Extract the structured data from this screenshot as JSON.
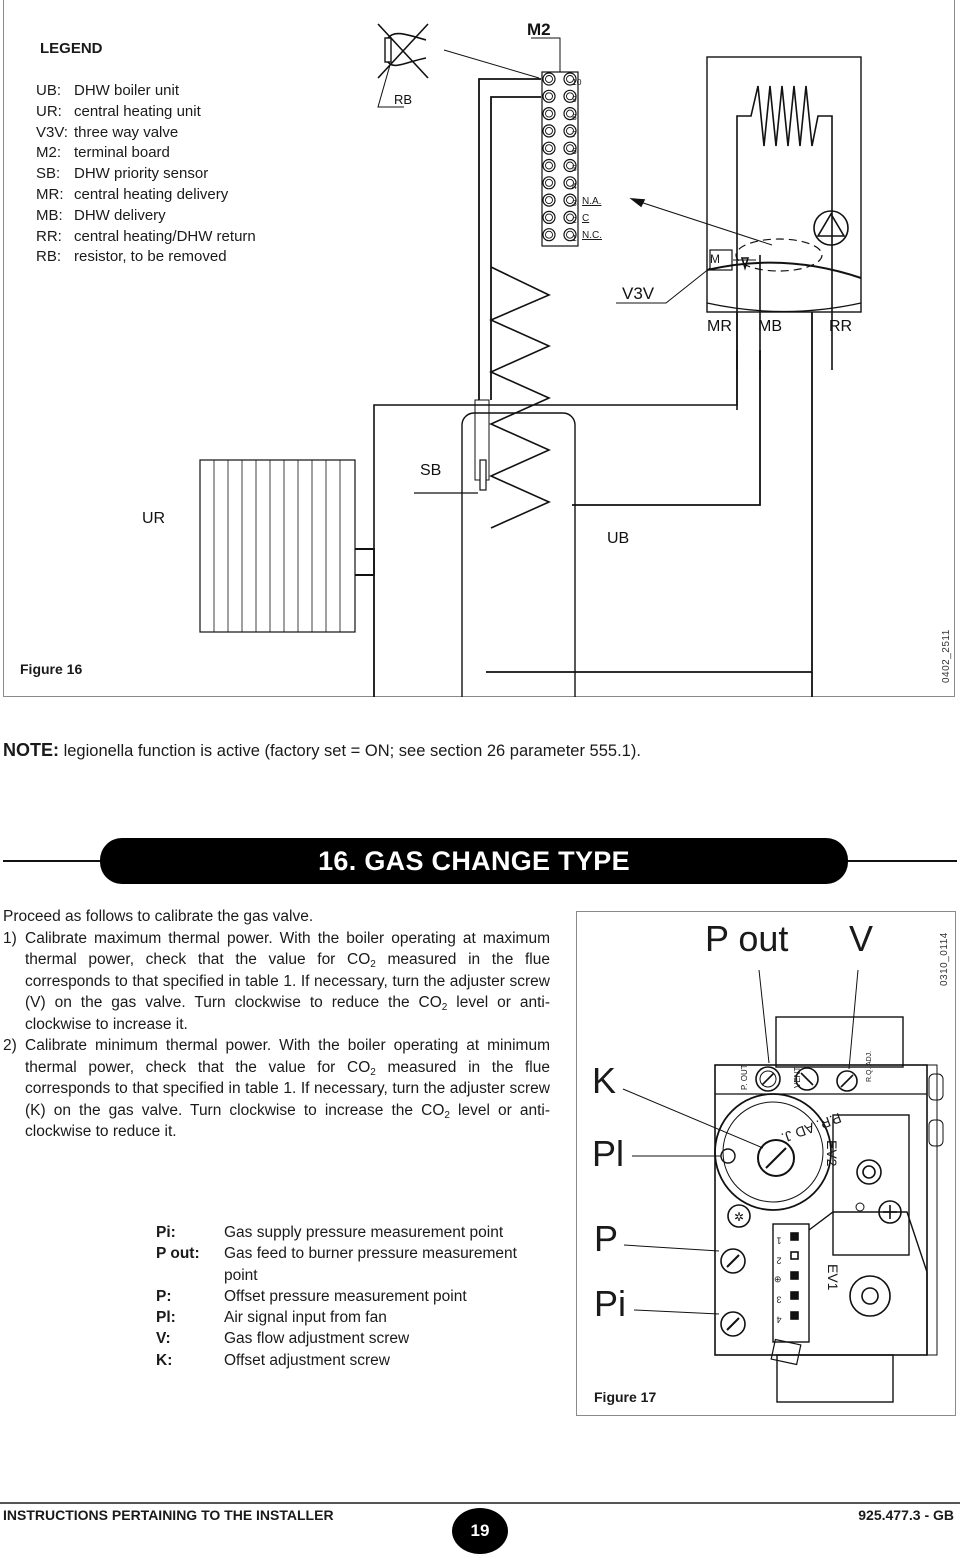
{
  "figure16": {
    "legend_title": "LEGEND",
    "legend": [
      {
        "key": "UB:",
        "value": "DHW boiler unit"
      },
      {
        "key": "UR:",
        "value": "central heating unit"
      },
      {
        "key": "V3V:",
        "value": "three way valve"
      },
      {
        "key": "M2:",
        "value": "terminal board"
      },
      {
        "key": "SB:",
        "value": "DHW priority sensor"
      },
      {
        "key": "MR:",
        "value": "central heating delivery"
      },
      {
        "key": "MB:",
        "value": "DHW delivery"
      },
      {
        "key": "RR:",
        "value": "central heating/DHW return"
      },
      {
        "key": "RB:",
        "value": "resistor, to be removed"
      }
    ],
    "labels": {
      "rb": "RB",
      "m2": "M2",
      "v3v": "V3V",
      "mr": "MR",
      "mb": "MB",
      "rr": "RR",
      "sb": "SB",
      "ur": "UR",
      "ub": "UB",
      "motor": "M",
      "terminal_na": "N.A.",
      "terminal_c": "C",
      "terminal_nc": "N.C."
    },
    "terminal_numbers": [
      "10",
      "9",
      "8",
      "7",
      "6",
      "5",
      "4",
      "3",
      "2",
      "1"
    ],
    "caption": "Figure 16",
    "code": "0402_2511"
  },
  "note": {
    "label": "NOTE:",
    "text": " legionella function is active (factory set = ON; see section 26 parameter 555.1)."
  },
  "section": {
    "heading": "16. GAS CHANGE TYPE",
    "intro": "Proceed as follows to calibrate the gas valve.",
    "steps": [
      {
        "num": "1)",
        "a": "Calibrate maximum thermal power. With the boiler operating at maximum thermal power, check that the value for CO",
        "b": " measured in the flue corresponds to that specified in table 1. If necessary, turn the adjuster screw (V) on the gas valve. Turn clockwise to reduce the CO",
        "c": " level or anti-clockwise to increase it."
      },
      {
        "num": "2)",
        "a": "Calibrate minimum thermal power. With the boiler operating at minimum thermal power, check that the value for CO",
        "b": " measured in the flue corresponds to that specified in table 1. If necessary, turn the adjuster screw (K) on the gas valve. Turn clockwise to increase the CO",
        "c": " level or anti-clockwise to reduce it."
      }
    ],
    "subscript": "2"
  },
  "symbols": [
    {
      "key": "Pi:",
      "value": "Gas supply pressure measurement point"
    },
    {
      "key": "P out:",
      "value": "Gas feed to burner pressure measurement point"
    },
    {
      "key": "P:",
      "value": "Offset pressure measurement point"
    },
    {
      "key": "Pl:",
      "value": "Air signal input from fan"
    },
    {
      "key": "V:",
      "value": "Gas flow adjustment screw"
    },
    {
      "key": "K:",
      "value": "Offset adjustment screw"
    }
  ],
  "figure17": {
    "labels": {
      "p_out": "P out",
      "v": "V",
      "k": "K",
      "pl": "Pl",
      "p": "P",
      "pi": "Pi",
      "p_out_small": "P. OUT",
      "vent": "VENT",
      "rq_adj": "R.Q. ADJ.",
      "pr_adj": "P.R. AD J.",
      "ev1": "EV1",
      "ev2": "EV2"
    },
    "connector_pins": [
      "1",
      "2",
      "⊕",
      "3",
      "4"
    ],
    "caption": "Figure 17",
    "code": "0310_0114"
  },
  "footer": {
    "left": "INSTRUCTIONS PERTAINING TO THE INSTALLER",
    "page": "19",
    "right": "925.477.3 - GB"
  }
}
